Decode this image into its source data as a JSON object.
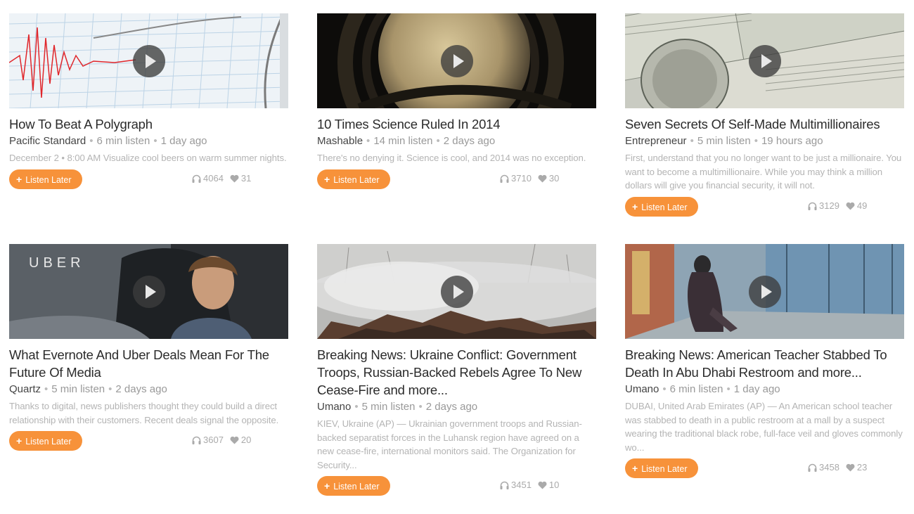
{
  "listen_later_label": "Listen Later",
  "colors": {
    "accent": "#f7923a",
    "title": "#2b2b2b",
    "meta": "#999999",
    "desc": "#b4b4b4"
  },
  "cards": [
    {
      "title": "How To Beat A Polygraph",
      "source": "Pacific Standard",
      "duration": "6 min listen",
      "age": "1 day ago",
      "description": "December 2 • 8:00 AM Visualize cool beers on warm summer nights.",
      "listens": "4064",
      "likes": "31",
      "image": "seismograph"
    },
    {
      "title": "10 Times Science Ruled In 2014",
      "source": "Mashable",
      "duration": "14 min listen",
      "age": "2 days ago",
      "description": "There's no denying it. Science is cool, and 2014 was no exception.",
      "listens": "3710",
      "likes": "30",
      "image": "saturn"
    },
    {
      "title": "Seven Secrets Of Self-Made Multimillionaires",
      "source": "Entrepreneur",
      "duration": "5 min listen",
      "age": "19 hours ago",
      "description": "First, understand that you no longer want to be just a millionaire. You want to become a multimillionaire. While you may think a million dollars will give you financial security, it will not.",
      "listens": "3129",
      "likes": "49",
      "image": "dollar-bills"
    },
    {
      "title": "What Evernote And Uber Deals Mean For The Future Of Media",
      "source": "Quartz",
      "duration": "5 min listen",
      "age": "2 days ago",
      "description": "Thanks to digital, news publishers thought they could build a direct relationship with their customers. Recent deals signal the opposite.",
      "listens": "3607",
      "likes": "20",
      "image": "uber-driver",
      "image_text": "UBER"
    },
    {
      "title": "Breaking News: Ukraine Conflict: Government Troops, Russian-Backed Rebels Agree To New Cease-Fire and more...",
      "source": "Umano",
      "duration": "5 min listen",
      "age": "2 days ago",
      "description": "KIEV, Ukraine (AP) — Ukrainian government troops and Russian-backed separatist forces in the Luhansk region have agreed on a new cease-fire, international monitors said. The Organization for Security...",
      "listens": "3451",
      "likes": "10",
      "image": "smoke-rubble"
    },
    {
      "title": "Breaking News: American Teacher Stabbed To Death In Abu Dhabi Restroom and more...",
      "source": "Umano",
      "duration": "6 min listen",
      "age": "1 day ago",
      "description": "DUBAI, United Arab Emirates (AP) — An American school teacher was stabbed to death in a public restroom at a mall by a suspect wearing the traditional black robe, full-face veil and gloves commonly wo...",
      "listens": "3458",
      "likes": "23",
      "image": "cctv-mall"
    }
  ]
}
